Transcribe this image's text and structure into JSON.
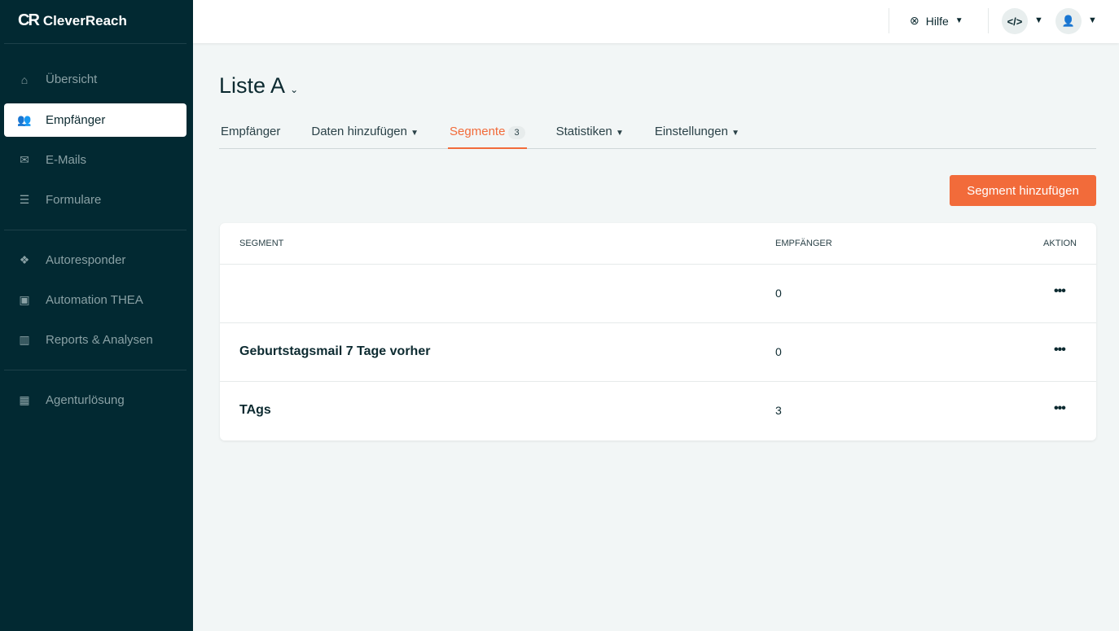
{
  "brand": "CleverReach",
  "sidebar": {
    "items": [
      {
        "label": "Übersicht",
        "icon": "home-icon"
      },
      {
        "label": "Empfänger",
        "icon": "users-icon"
      },
      {
        "label": "E-Mails",
        "icon": "envelope-icon"
      },
      {
        "label": "Formulare",
        "icon": "form-icon"
      },
      {
        "label": "Autoresponder",
        "icon": "cubes-icon"
      },
      {
        "label": "Automation THEA",
        "icon": "robot-icon"
      },
      {
        "label": "Reports & Analysen",
        "icon": "chart-icon"
      },
      {
        "label": "Agenturlösung",
        "icon": "grid-icon"
      }
    ]
  },
  "topbar": {
    "help": "Hilfe",
    "code": "</>"
  },
  "page": {
    "title": "Liste A",
    "tabs": [
      {
        "label": "Empfänger"
      },
      {
        "label": "Daten hinzufügen"
      },
      {
        "label": "Segmente",
        "badge": "3"
      },
      {
        "label": "Statistiken"
      },
      {
        "label": "Einstellungen"
      }
    ],
    "add_button": "Segment hinzufügen"
  },
  "table": {
    "headers": [
      "SEGMENT",
      "EMPFÄNGER",
      "AKTION"
    ],
    "rows": [
      {
        "name": "",
        "count": "0"
      },
      {
        "name": "Geburtstagsmail 7 Tage vorher",
        "count": "0"
      },
      {
        "name": "TAgs",
        "count": "3"
      }
    ]
  }
}
